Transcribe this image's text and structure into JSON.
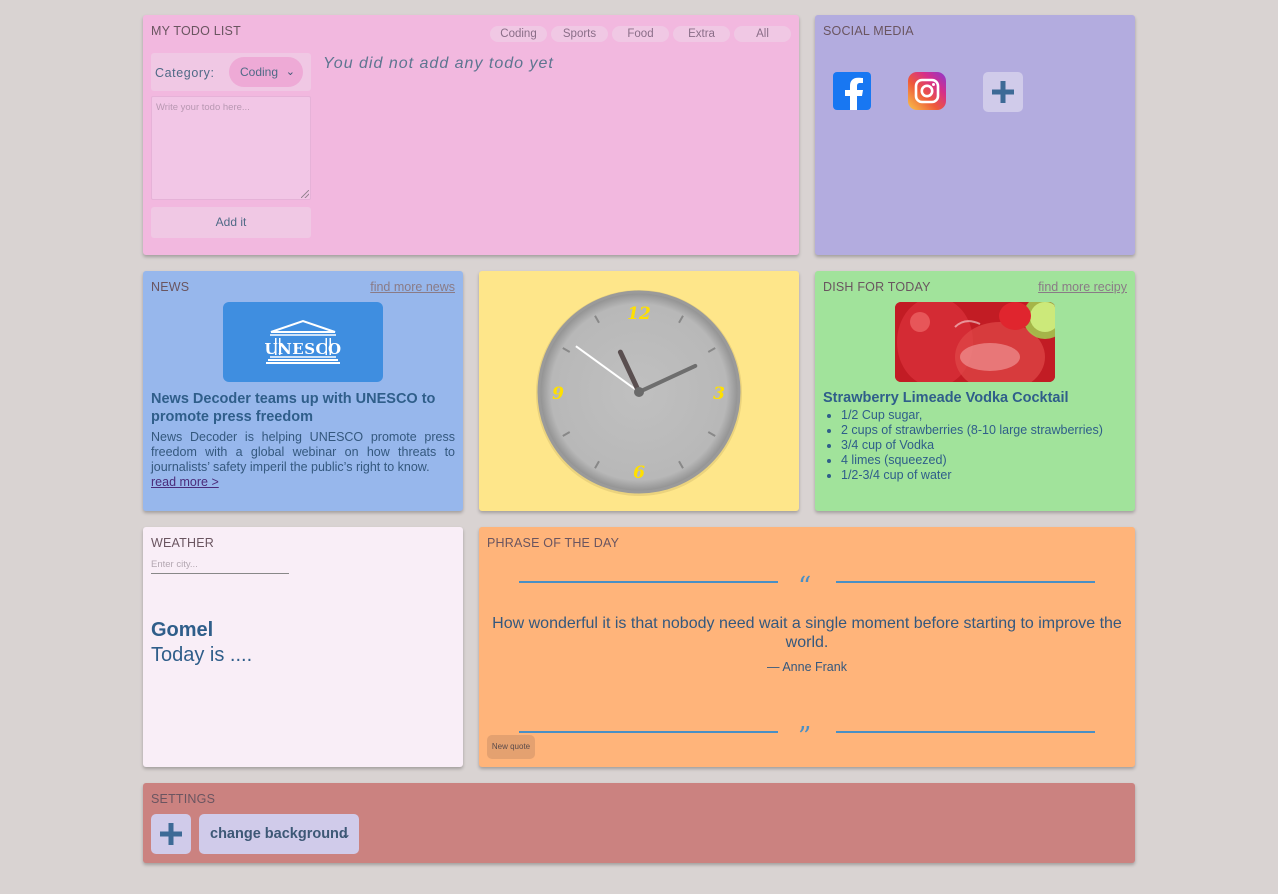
{
  "todo": {
    "title": "MY TODO LIST",
    "filters": [
      "Coding",
      "Sports",
      "Food",
      "Extra",
      "All"
    ],
    "category_label": "Category:",
    "category_value": "Coding",
    "textarea_placeholder": "Write your todo here...",
    "add_label": "Add it",
    "empty_message": "You did not add any todo yet"
  },
  "social": {
    "title": "SOCIAL MEDIA",
    "icons": [
      "facebook-icon",
      "instagram-icon",
      "plus-icon"
    ]
  },
  "news": {
    "title": "NEWS",
    "link": "find more news",
    "logo_text": "UNESCO",
    "headline": "News Decoder teams up with UNESCO to promote press freedom",
    "body": "News Decoder is helping UNESCO promote press freedom with a global webinar on how threats to journalists’ safety imperil the public’s right to know.",
    "read_more": "read more >"
  },
  "clock": {
    "numbers": [
      "12",
      "3",
      "6",
      "9"
    ],
    "hour": 11,
    "minute": 10,
    "second": 51,
    "number_color": "#ffe000"
  },
  "dish": {
    "title": "DISH FOR TODAY",
    "link": "find more recipy",
    "name": "Strawberry Limeade Vodka Cocktail",
    "ingredients": [
      "1/2 Cup sugar,",
      "2 cups of strawberries (8-10 large strawberries)",
      "3/4 cup of Vodka",
      "4 limes (squeezed)",
      "1/2-3/4 cup of water"
    ]
  },
  "weather": {
    "title": "WEATHER",
    "city_placeholder": "Enter city...",
    "city": "Gomel",
    "today": "Today is ...."
  },
  "phrase": {
    "title": "PHRASE OF THE DAY",
    "open_quote": "“",
    "close_quote": "”",
    "quote": "How wonderful it is that nobody need wait a single moment before starting to improve the world.",
    "author": "— Anne Frank",
    "new_quote_label": "New quote"
  },
  "settings": {
    "title": "SETTINGS",
    "select_value": "change background"
  },
  "colors": {
    "todo_bg": "#f2b8df",
    "social_bg": "#b3acdf",
    "news_bg": "#97b7ec",
    "clock_bg": "#fee68a",
    "dish_bg": "#a1e39b",
    "weather_bg": "#f9eef7",
    "phrase_bg": "#ffb47a",
    "settings_bg": "#cb8280",
    "page_bg": "#d9d3d2"
  }
}
